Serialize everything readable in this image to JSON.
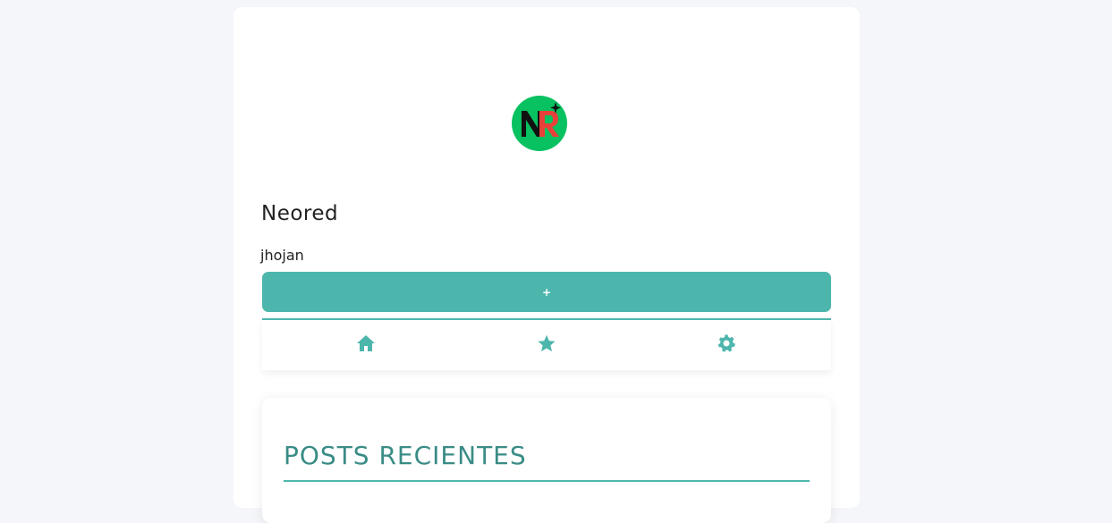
{
  "profile": {
    "site_name": "Neored",
    "username": "jhojan",
    "logo": {
      "letters": "NR",
      "background_color": "#08c160",
      "icon": "sparkle-icon"
    }
  },
  "actions": {
    "add_label": "+"
  },
  "nav": {
    "items": [
      {
        "icon": "home-icon"
      },
      {
        "icon": "star-icon"
      },
      {
        "icon": "gear-icon"
      }
    ]
  },
  "posts": {
    "title": "POSTS RECIENTES"
  },
  "colors": {
    "accent": "#4db6ac",
    "title": "#3a8c86",
    "background": "#f4f6fa"
  }
}
